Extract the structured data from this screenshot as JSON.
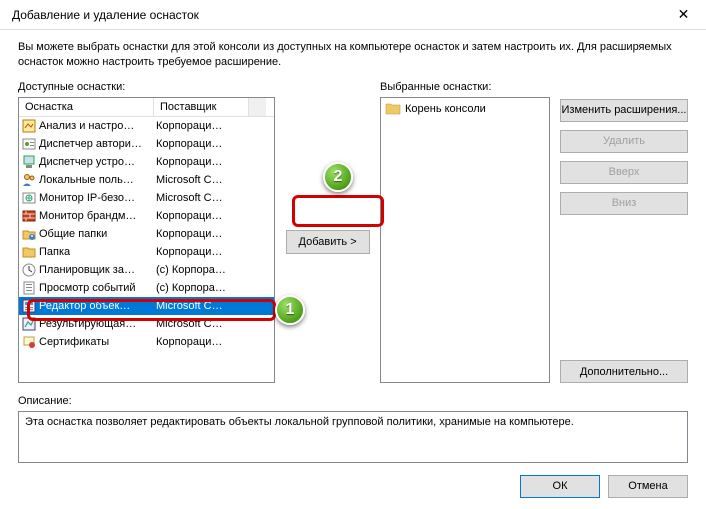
{
  "window": {
    "title": "Добавление и удаление оснасток",
    "close_symbol": "✕"
  },
  "intro": "Вы можете выбрать оснастки для этой консоли из доступных на компьютере оснасток и затем настроить их. Для расширяемых оснасток можно настроить требуемое расширение.",
  "available": {
    "label": "Доступные оснастки:",
    "columns": {
      "name": "Оснастка",
      "vendor": "Поставщик"
    },
    "rows": [
      {
        "name": "Анализ и настро…",
        "vendor": "Корпораци…",
        "icon": "analysis",
        "selected": false
      },
      {
        "name": "Диспетчер автори…",
        "vendor": "Корпораци…",
        "icon": "auth",
        "selected": false
      },
      {
        "name": "Диспетчер устро…",
        "vendor": "Корпораци…",
        "icon": "device",
        "selected": false
      },
      {
        "name": "Локальные поль…",
        "vendor": "Microsoft C…",
        "icon": "users",
        "selected": false
      },
      {
        "name": "Монитор IP-безо…",
        "vendor": "Microsoft C…",
        "icon": "ipmon",
        "selected": false
      },
      {
        "name": "Монитор брандм…",
        "vendor": "Корпораци…",
        "icon": "firewall",
        "selected": false
      },
      {
        "name": "Общие папки",
        "vendor": "Корпораци…",
        "icon": "shared",
        "selected": false
      },
      {
        "name": "Папка",
        "vendor": "Корпораци…",
        "icon": "folder",
        "selected": false
      },
      {
        "name": "Планировщик за…",
        "vendor": "(с) Корпора…",
        "icon": "scheduler",
        "selected": false
      },
      {
        "name": "Просмотр событий",
        "vendor": "(с) Корпора…",
        "icon": "events",
        "selected": false
      },
      {
        "name": "Редактор объек…",
        "vendor": "Microsoft C…",
        "icon": "gpedit",
        "selected": true
      },
      {
        "name": "Результирующая…",
        "vendor": "Microsoft C…",
        "icon": "rsop",
        "selected": false
      },
      {
        "name": "Сертификаты",
        "vendor": "Корпораци…",
        "icon": "cert",
        "selected": false
      }
    ]
  },
  "add_button": "Добавить >",
  "selected": {
    "label": "Выбранные оснастки:",
    "root": "Корень консоли"
  },
  "side_buttons": {
    "edit_ext": "Изменить расширения...",
    "remove": "Удалить",
    "up": "Вверх",
    "down": "Вниз",
    "advanced": "Дополнительно..."
  },
  "description": {
    "label": "Описание:",
    "text": "Эта оснастка позволяет редактировать объекты локальной групповой политики, хранимые на компьютере."
  },
  "footer": {
    "ok": "ОК",
    "cancel": "Отмена"
  },
  "callouts": {
    "c1": "1",
    "c2": "2"
  }
}
